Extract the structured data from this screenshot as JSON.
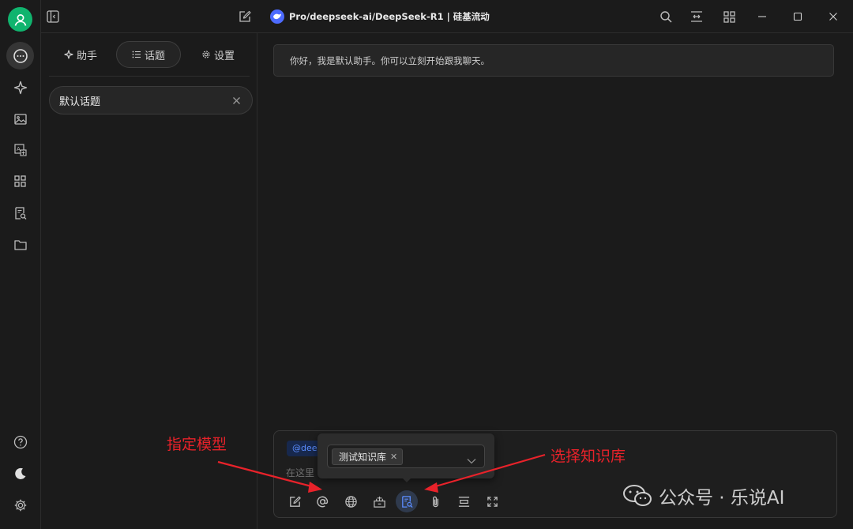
{
  "app": {
    "model_title": "Pro/deepseek-ai/DeepSeek-R1 | 硅基流动"
  },
  "rail": {
    "items": [
      {
        "name": "chat",
        "icon": "chat-bubble-icon",
        "active": true
      },
      {
        "name": "agents",
        "icon": "sparkle-icon"
      },
      {
        "name": "paintings",
        "icon": "image-icon"
      },
      {
        "name": "translate",
        "icon": "translate-icon"
      },
      {
        "name": "apps",
        "icon": "grid-icon"
      },
      {
        "name": "knowledge",
        "icon": "knowledge-icon"
      },
      {
        "name": "files",
        "icon": "folder-icon"
      }
    ],
    "bottom": [
      "help-icon",
      "moon-icon",
      "settings-gear-icon"
    ]
  },
  "sidepanel": {
    "tabs": [
      {
        "label": "助手",
        "icon": "sparkle-icon"
      },
      {
        "label": "话题",
        "icon": "list-icon",
        "active": true
      },
      {
        "label": "设置",
        "icon": "gear-icon"
      }
    ],
    "topics": [
      {
        "label": "默认话题"
      }
    ]
  },
  "chat": {
    "greeting": "你好，我是默认助手。你可以立刻开始跟我聊天。",
    "input": {
      "mention_chip": "@dee",
      "placeholder": "在这里"
    },
    "knowledge_popup": {
      "selected": "测试知识库"
    }
  },
  "annotations": {
    "model_label": "指定模型",
    "kb_label": "选择知识库",
    "color": "#e8222a"
  },
  "watermark": {
    "text": "公众号 · 乐说AI"
  },
  "colors": {
    "accent": "#10b46e",
    "background": "#1b1b1b",
    "link": "#5b8dff"
  }
}
